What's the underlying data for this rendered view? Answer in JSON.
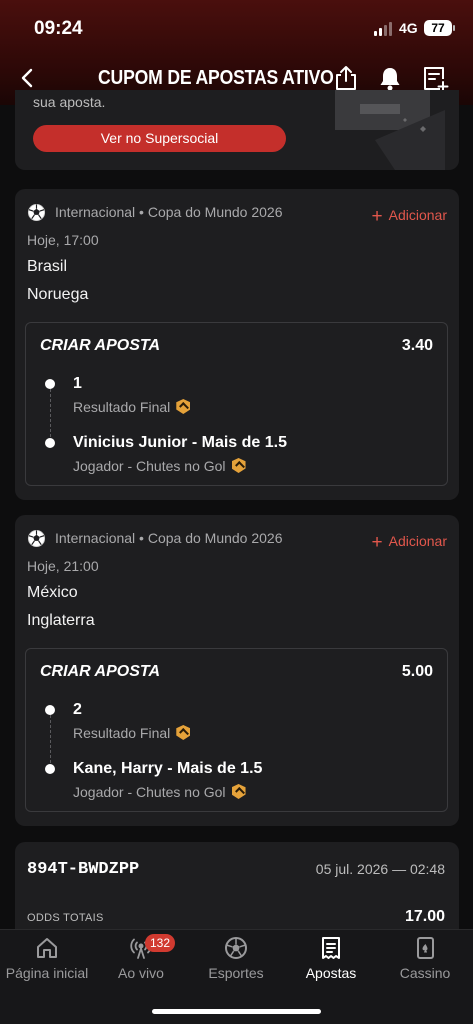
{
  "status": {
    "time": "09:24",
    "network": "4G",
    "battery": "77"
  },
  "nav": {
    "title": "CUPOM DE APOSTAS ATIVO"
  },
  "promo": {
    "text": "sua aposta.",
    "button": "Ver no Supersocial"
  },
  "matches": [
    {
      "league": "Internacional • Copa do Mundo 2026",
      "add_label": "Adicionar",
      "kickoff": "Hoje, 17:00",
      "home": "Brasil",
      "away": "Noruega",
      "bet_title": "CRIAR APOSTA",
      "odd": "3.40",
      "legs": [
        {
          "selection": "1",
          "market": "Resultado Final"
        },
        {
          "selection": "Vinicius Junior - Mais de 1.5",
          "market": "Jogador - Chutes no Gol"
        }
      ]
    },
    {
      "league": "Internacional • Copa do Mundo 2026",
      "add_label": "Adicionar",
      "kickoff": "Hoje, 21:00",
      "home": "México",
      "away": "Inglaterra",
      "bet_title": "CRIAR APOSTA",
      "odd": "5.00",
      "legs": [
        {
          "selection": "2",
          "market": "Resultado Final"
        },
        {
          "selection": "Kane, Harry - Mais de 1.5",
          "market": "Jogador - Chutes no Gol"
        }
      ]
    }
  ],
  "summary": {
    "code": "894T-BWDZPP",
    "date": "05 jul. 2026 — 02:48",
    "odds_label": "ODDS TOTAIS",
    "odds_value": "17.00"
  },
  "tabs": [
    {
      "label": "Página inicial",
      "icon": "home-icon"
    },
    {
      "label": "Ao vivo",
      "icon": "live-icon",
      "badge": "132"
    },
    {
      "label": "Esportes",
      "icon": "soccer-ball-icon"
    },
    {
      "label": "Apostas",
      "icon": "betslip-icon",
      "active": true
    },
    {
      "label": "Cassino",
      "icon": "cards-icon"
    }
  ],
  "colors": {
    "accent": "#c42f2b",
    "add": "#e2574c",
    "badge": "#e5a23a",
    "card": "#1e1e20",
    "background": "#0d0d0e"
  }
}
